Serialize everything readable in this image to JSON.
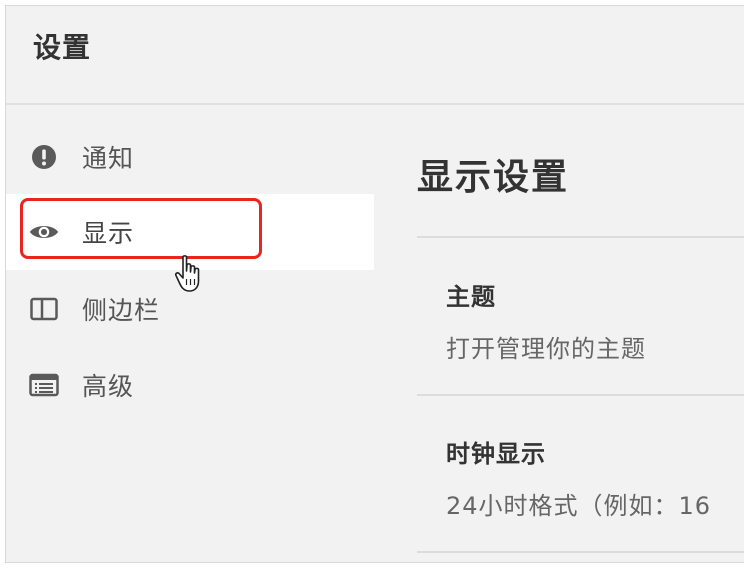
{
  "window": {
    "title": "设置"
  },
  "sidebar": {
    "items": [
      {
        "label": "通知",
        "icon": "alert-icon"
      },
      {
        "label": "显示",
        "icon": "eye-icon",
        "active": true
      },
      {
        "label": "侧边栏",
        "icon": "sidebar-icon"
      },
      {
        "label": "高级",
        "icon": "advanced-icon"
      }
    ]
  },
  "main": {
    "title": "显示设置",
    "rows": [
      {
        "title": "主题",
        "description": "打开管理你的主题"
      },
      {
        "title": "时钟显示",
        "description": "24小时格式（例如：16"
      }
    ]
  },
  "colors": {
    "highlight": "#e8261f",
    "background": "#f2f2f2",
    "active_item": "#ffffff"
  }
}
